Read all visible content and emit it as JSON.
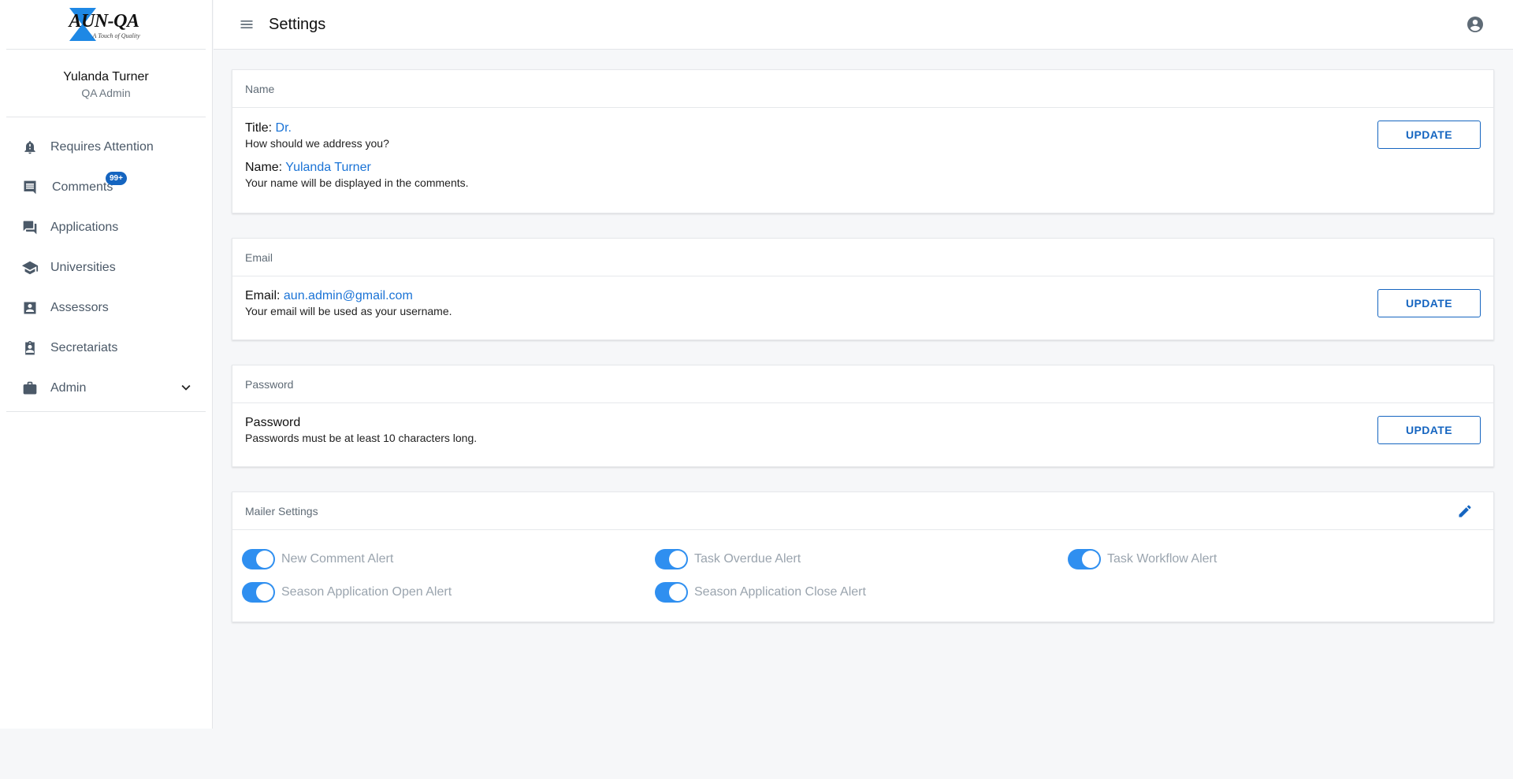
{
  "app": {
    "logo_text": "AUN-QA",
    "logo_tagline": "A Touch of Quality",
    "accent": "#1565c0"
  },
  "header": {
    "title": "Settings",
    "menu_icon": "menu-icon",
    "account_icon": "account-circle-icon"
  },
  "profile": {
    "name": "Yulanda Turner",
    "role": "QA Admin"
  },
  "sidebar": {
    "items": [
      {
        "label": "Requires Attention",
        "icon": "bell-alert-icon"
      },
      {
        "label": "Comments",
        "icon": "comment-icon",
        "badge": "99+"
      },
      {
        "label": "Applications",
        "icon": "forum-icon"
      },
      {
        "label": "Universities",
        "icon": "school-icon"
      },
      {
        "label": "Assessors",
        "icon": "account-box-icon"
      },
      {
        "label": "Secretariats",
        "icon": "clipboard-account-icon"
      },
      {
        "label": "Admin",
        "icon": "briefcase-icon",
        "expandable": true
      }
    ]
  },
  "name_card": {
    "header": "Name",
    "title_label": "Title:",
    "title_value": "Dr.",
    "title_hint": "How should we address you?",
    "name_label": "Name:",
    "name_value": "Yulanda Turner",
    "name_hint": "Your name will be displayed in the comments.",
    "button": "UPDATE"
  },
  "email_card": {
    "header": "Email",
    "email_label": "Email:",
    "email_value": "aun.admin@gmail.com",
    "email_hint": "Your email will be used as your username.",
    "button": "UPDATE"
  },
  "password_card": {
    "header": "Password",
    "password_label": "Password",
    "password_hint": "Passwords must be at least 10 characters long.",
    "button": "UPDATE"
  },
  "mailer_card": {
    "header": "Mailer Settings",
    "edit_icon": "pencil-icon",
    "toggles": [
      {
        "label": "New Comment Alert",
        "on": true
      },
      {
        "label": "Task Overdue Alert",
        "on": true
      },
      {
        "label": "Task Workflow Alert",
        "on": true
      },
      {
        "label": "Season Application Open Alert",
        "on": true
      },
      {
        "label": "Season Application Close Alert",
        "on": true
      }
    ]
  }
}
